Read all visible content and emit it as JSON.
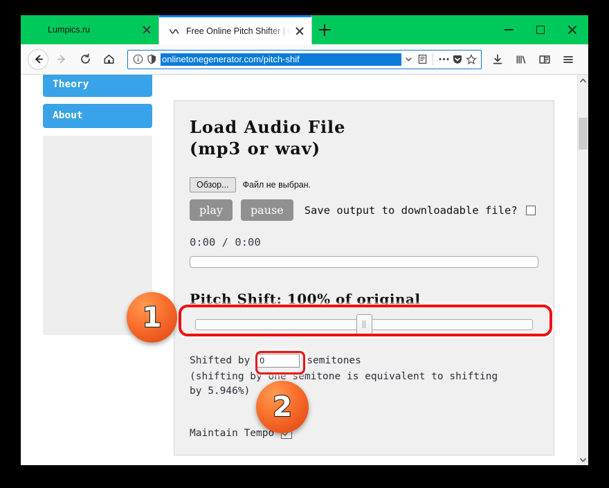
{
  "browser": {
    "tabs": [
      {
        "title": "Lumpics.ru",
        "favicon": "citrus-icon",
        "active": false
      },
      {
        "title": "Free Online Pitch Shifter | Onlin",
        "favicon": "sine-wave-icon",
        "active": true
      }
    ],
    "new_tab_label": "+",
    "window_controls": {
      "minimize": "minimize-icon",
      "maximize": "maximize-icon",
      "close": "close-icon"
    },
    "nav": {
      "back": "back-arrow-icon",
      "forward": "forward-arrow-icon",
      "reload": "reload-icon",
      "home": "home-icon"
    },
    "url": "onlinetonegenerator.com/pitch-shif",
    "url_selected": true,
    "url_icons": [
      "info-icon",
      "shield-icon"
    ],
    "url_right_icons": [
      "chevron-down-icon",
      "reader-view-icon",
      "more-dots-icon",
      "pocket-icon",
      "star-icon"
    ],
    "toolbar_right_icons": [
      "download-icon",
      "library-icon",
      "sidebar-icon",
      "menu-icon"
    ],
    "chrome_color": "#00c95c",
    "active_tab_accent": "#0a84ff",
    "url_highlight_color": "#0a7bd8"
  },
  "sidebar": {
    "items": [
      {
        "label": "Acoustic Theory",
        "clipped": true
      },
      {
        "label": "About",
        "clipped": false
      }
    ],
    "ad_placeholder": "",
    "button_color": "#38a3e8"
  },
  "page": {
    "heading_line1": "Load Audio File",
    "heading_line2": "(mp3 or wav)",
    "file_input": {
      "button_label": "Обзор...",
      "status": "Файл не выбран."
    },
    "transport": {
      "play_label": "play",
      "pause_label": "pause"
    },
    "save_output": {
      "label": "Save output to downloadable file?",
      "checked": false
    },
    "timecode": "0:00 / 0:00",
    "progress_value": 0,
    "pitch_shift": {
      "label": "Pitch Shift: 100% of original",
      "percent": 100,
      "slider_value": 50
    },
    "semitones": {
      "prefix": "Shifted by",
      "value": "0",
      "suffix": "semitones",
      "note_line1": "(shifting by one semitone is equivalent to shifting",
      "note_line2": "by 5.946%)"
    },
    "maintain_tempo": {
      "label": "Maintain Tempo",
      "checked": true
    }
  },
  "annotations": {
    "badge1": "1",
    "badge2": "2",
    "highlight_color": "#ee1111",
    "badge_color": "#f4651f"
  }
}
